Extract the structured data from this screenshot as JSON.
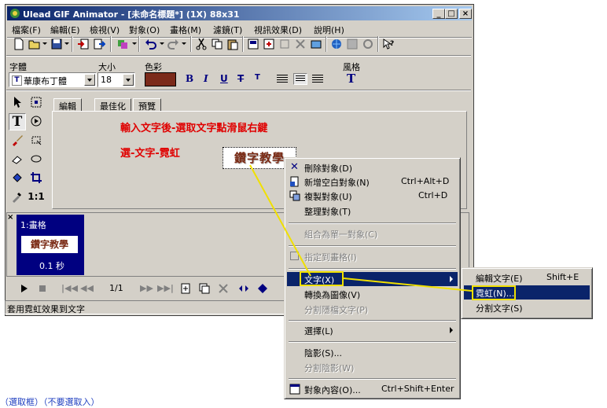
{
  "window": {
    "title": "Ulead GIF Animator - [未命名標題*] (1X) 88x31",
    "controls": [
      "_",
      "□",
      "×"
    ]
  },
  "menubar": [
    "檔案(F)",
    "編輯(E)",
    "檢視(V)",
    "對象(O)",
    "畫格(M)",
    "濾鏡(T)",
    "視訊效果(D)",
    "說明(H)"
  ],
  "toolbar": {
    "icons": [
      "new-icon",
      "open-icon",
      "save-icon",
      "import-icon",
      "export-icon",
      "object-icon",
      "undo-icon",
      "redo-icon",
      "cut-icon",
      "copy-icon",
      "paste-icon",
      "frame-icon",
      "frame-props-icon",
      "delete-frame-icon",
      "tween-icon",
      "optimize-icon",
      "web-icon",
      "preview-icon",
      "help-icon"
    ]
  },
  "format": {
    "font_label": "字體",
    "font_value": "華康布丁體",
    "size_label": "大小",
    "size_value": "18",
    "color_label": "色彩",
    "color_value": "#7b2a1a",
    "style_label": "風格",
    "buttons": [
      "B",
      "I",
      "U",
      "T",
      "T"
    ]
  },
  "tabs": [
    "編輯",
    "最佳化",
    "預覽"
  ],
  "instructions": {
    "line1": "輸入文字後-選取文字點滑鼠右鍵",
    "line2": "選-文字-霓虹"
  },
  "text_object": "鑽字教學",
  "frame_panel": {
    "frame_label": "1:畫格",
    "thumb_text": "鑽字教學",
    "delay": "0.1 秒",
    "counter": "1/1"
  },
  "status_text": "套用霓虹效果到文字",
  "context_menu": {
    "items": [
      {
        "label": "刪除對象(D)",
        "shortcut": "",
        "enabled": true
      },
      {
        "label": "新增空白對象(N)",
        "shortcut": "Ctrl+Alt+D",
        "enabled": true
      },
      {
        "label": "複製對象(U)",
        "shortcut": "Ctrl+D",
        "enabled": true
      },
      {
        "label": "整理對象(T)",
        "shortcut": "",
        "enabled": true
      },
      {
        "label": "組合為單一對象(C)",
        "shortcut": "",
        "enabled": false
      },
      {
        "label": "指定到畫格(I)",
        "shortcut": "",
        "enabled": false
      },
      {
        "label": "文字(X)",
        "shortcut": "",
        "enabled": true
      },
      {
        "label": "轉換為圖像(V)",
        "shortcut": "",
        "enabled": true
      },
      {
        "label": "分割隱檔文字(P)",
        "shortcut": "",
        "enabled": false
      },
      {
        "label": "選擇(L)",
        "shortcut": "",
        "enabled": true
      },
      {
        "label": "陰影(S)...",
        "shortcut": "",
        "enabled": true
      },
      {
        "label": "分割陰影(W)",
        "shortcut": "",
        "enabled": false
      },
      {
        "label": "對象內容(O)...",
        "shortcut": "Ctrl+Shift+Enter",
        "enabled": true
      }
    ]
  },
  "submenu": {
    "items": [
      {
        "label": "編輯文字(E)",
        "shortcut": "Shift+E"
      },
      {
        "label": "霓虹(N)...",
        "shortcut": ""
      },
      {
        "label": "分割文字(S)",
        "shortcut": ""
      }
    ]
  },
  "bottom_text": "（選取框）（不要選取入）",
  "colors": {
    "highlight": "#0a246a",
    "annotation": "#f0e000",
    "instruction": "#e00000"
  }
}
